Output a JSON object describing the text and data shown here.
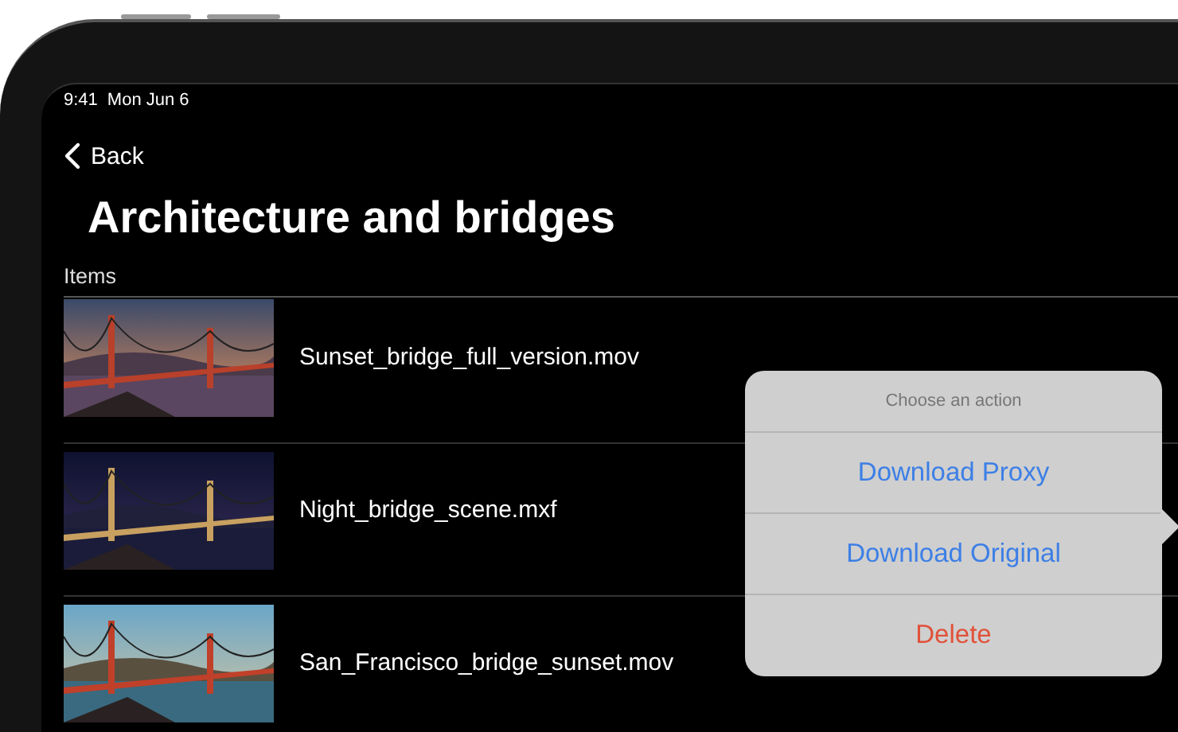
{
  "status_bar": {
    "time": "9:41",
    "date": "Mon Jun 6"
  },
  "nav": {
    "back": "Back",
    "title": "Architecture and bridges"
  },
  "section": {
    "header": "Items"
  },
  "items": [
    {
      "name": "Sunset_bridge_full_version.mov"
    },
    {
      "name": "Night_bridge_scene.mxf"
    },
    {
      "name": "San_Francisco_bridge_sunset.mov"
    }
  ],
  "action_sheet": {
    "title": "Choose an action",
    "actions": [
      {
        "label": "Download Proxy",
        "kind": "default"
      },
      {
        "label": "Download Original",
        "kind": "default"
      },
      {
        "label": "Delete",
        "kind": "destructive"
      }
    ]
  }
}
